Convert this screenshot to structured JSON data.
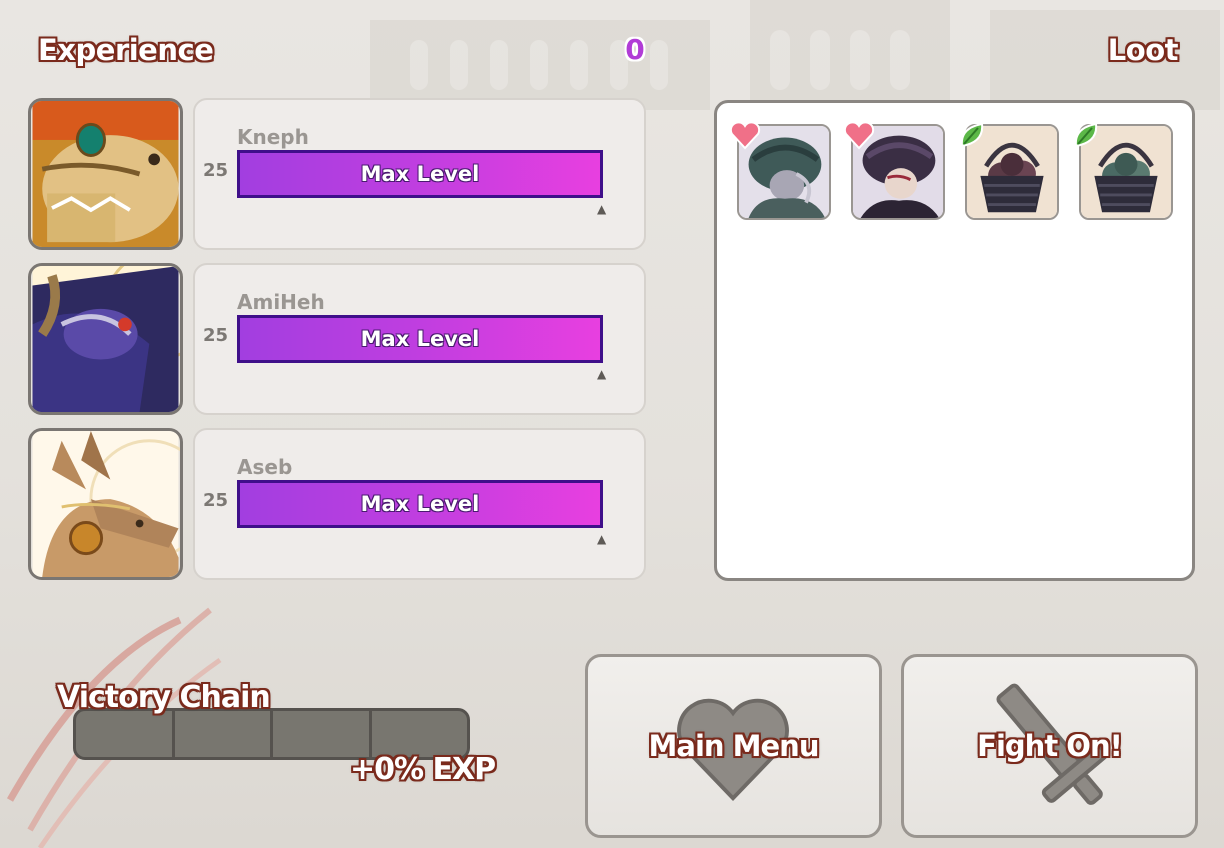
{
  "header": {
    "experience_label": "Experience",
    "exp_gained": "0",
    "loot_label": "Loot"
  },
  "party": [
    {
      "name": "Kneph",
      "level": "25",
      "status": "Max Level",
      "portrait_icon": "tan-gold-dragon-portrait-icon"
    },
    {
      "name": "AmiHeh",
      "level": "25",
      "status": "Max Level",
      "portrait_icon": "purple-cloaked-dragon-portrait-icon"
    },
    {
      "name": "Aseb",
      "level": "25",
      "status": "Max Level",
      "portrait_icon": "brown-pendant-dragon-portrait-icon"
    }
  ],
  "loot": [
    {
      "icon": "green-turban-familiar-icon",
      "badge": "heart-icon"
    },
    {
      "icon": "purple-turban-familiar-icon",
      "badge": "heart-icon"
    },
    {
      "icon": "dark-fruit-basket-icon",
      "badge": "leaf-icon"
    },
    {
      "icon": "green-fruit-basket-icon",
      "badge": "leaf-icon"
    }
  ],
  "victory_chain": {
    "label": "Victory Chain",
    "bonus": "+0% EXP",
    "segments_filled": 0,
    "segments_total": 4
  },
  "buttons": {
    "main_menu": "Main Menu",
    "fight_on": "Fight On!"
  },
  "colors": {
    "xp_bar_start": "#a23ee0",
    "xp_bar_end": "#e83fe0",
    "title_outline": "#7a2a1c",
    "exp_count": "#b13cd6"
  }
}
